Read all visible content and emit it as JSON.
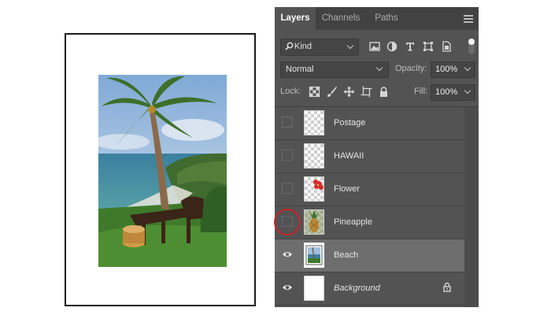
{
  "panel": {
    "tabs": [
      {
        "label": "Layers",
        "active": true
      },
      {
        "label": "Channels",
        "active": false
      },
      {
        "label": "Paths",
        "active": false
      }
    ],
    "filter": {
      "kind_label": "Kind"
    },
    "blend": {
      "mode": "Normal",
      "opacity_label": "Opacity:",
      "opacity_value": "100%"
    },
    "lock": {
      "label": "Lock:",
      "fill_label": "Fill:",
      "fill_value": "100%"
    },
    "layers": [
      {
        "name": "Postage",
        "visible": false,
        "selected": false,
        "italic": false,
        "thumb": "transparent"
      },
      {
        "name": "HAWAII",
        "visible": false,
        "selected": false,
        "italic": false,
        "thumb": "transparent"
      },
      {
        "name": "Flower",
        "visible": false,
        "selected": false,
        "italic": false,
        "thumb": "flower"
      },
      {
        "name": "Pineapple",
        "visible": false,
        "selected": false,
        "italic": false,
        "thumb": "pineapple"
      },
      {
        "name": "Beach",
        "visible": true,
        "selected": true,
        "italic": false,
        "thumb": "beach"
      },
      {
        "name": "Background",
        "visible": true,
        "selected": false,
        "italic": true,
        "thumb": "white",
        "locked": true
      }
    ]
  },
  "colors": {
    "panel_bg": "#535353",
    "tab_bar_bg": "#424242",
    "selected_row": "#6e6e6e",
    "highlight_circle": "#c8232c"
  },
  "icons": [
    "search-icon",
    "image-filter-icon",
    "adjustment-filter-icon",
    "type-filter-icon",
    "shape-filter-icon",
    "smart-object-filter-icon",
    "lock-transparent-icon",
    "lock-pixels-icon",
    "lock-position-icon",
    "lock-artboard-icon",
    "lock-all-icon",
    "eye-icon",
    "padlock-icon",
    "panel-menu-icon"
  ]
}
